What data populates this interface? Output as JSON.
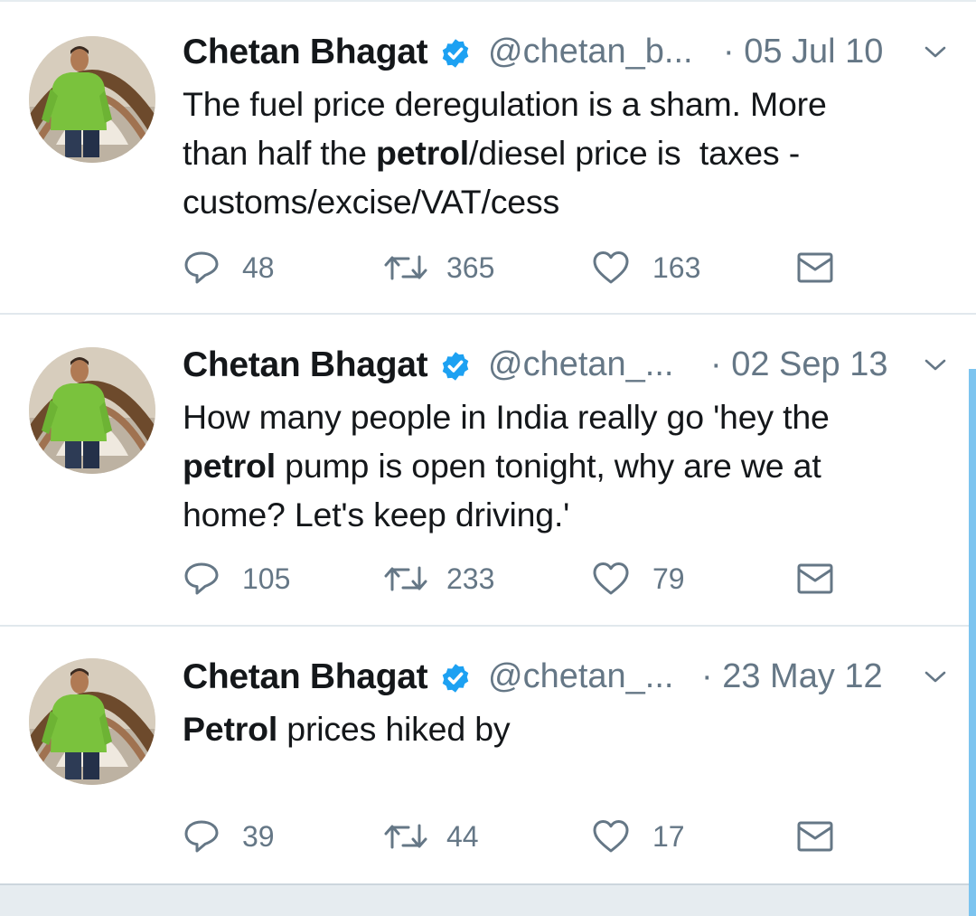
{
  "colors": {
    "text": "#14171a",
    "secondary": "#657786",
    "verified_badge": "#1da1f2",
    "divider": "#e1e8ed",
    "scroll_indicator": "#7cc4ef"
  },
  "icons": {
    "verified": "verified-badge-icon",
    "caret": "chevron-down-icon",
    "reply": "reply-icon",
    "retweet": "retweet-icon",
    "like": "heart-icon",
    "dm": "envelope-icon"
  },
  "tweets": [
    {
      "name": "Chetan Bhagat",
      "handle": "@chetan_b...",
      "date": "· 05 Jul 10",
      "text_html": "The fuel price deregulation is a sham. More\nthan half the <b>petrol</b>/diesel price is  taxes -\ncustoms/excise/VAT/cess",
      "replies": "48",
      "retweets": "365",
      "likes": "163"
    },
    {
      "name": "Chetan Bhagat",
      "handle": "@chetan_...",
      "date": "· 02 Sep 13",
      "text_html": "How many people in India really go 'hey the\n<b>petrol</b> pump is open tonight, why are we at\nhome? Let's keep driving.'",
      "replies": "105",
      "retweets": "233",
      "likes": "79"
    },
    {
      "name": "Chetan Bhagat",
      "handle": "@chetan_...",
      "date": "· 23 May 12",
      "text_html": "<b>Petrol</b> prices hiked by",
      "replies": "39",
      "retweets": "44",
      "likes": "17"
    }
  ]
}
